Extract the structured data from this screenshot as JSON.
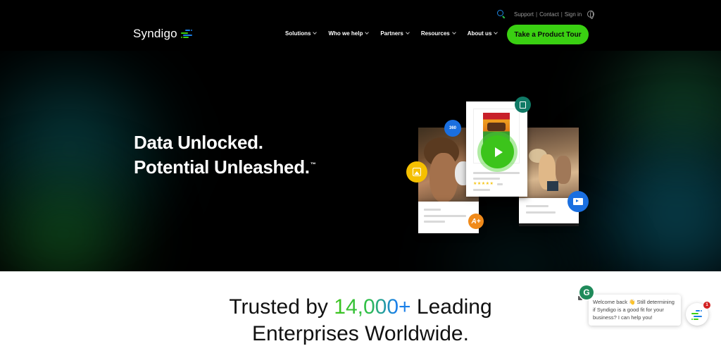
{
  "header": {
    "utility_links": [
      "Support",
      "Contact",
      "Sign in"
    ],
    "separator": "|",
    "logo_text": "Syndigo",
    "nav": [
      {
        "label": "Solutions"
      },
      {
        "label": "Who we help"
      },
      {
        "label": "Partners"
      },
      {
        "label": "Resources"
      },
      {
        "label": "About us"
      }
    ],
    "cta_label": "Take a Product Tour"
  },
  "hero": {
    "title_line1": "Data Unlocked.",
    "title_line2": "Potential Unleashed.",
    "trademark": "™",
    "collage": {
      "badges": [
        "360-view-icon",
        "image-icon",
        "edit-document-icon",
        "a-plus-content-icon",
        "video-card-icon"
      ],
      "a_plus_label": "A+",
      "rating_stars": "★★★★★",
      "product": "cereal box"
    }
  },
  "trusted": {
    "prefix": "Trusted by",
    "number": "14,000+",
    "suffix": "Leading",
    "line2": "Enterprises Worldwide."
  },
  "chat": {
    "avatar_letter": "G",
    "message": "Welcome back 👋 Still determining if Syndigo is a good fit for your business? I can help you!",
    "notification_count": "1"
  },
  "colors": {
    "brand_green": "#3ad012",
    "brand_blue": "#1a7fe8",
    "hero_bg": "#000000"
  }
}
